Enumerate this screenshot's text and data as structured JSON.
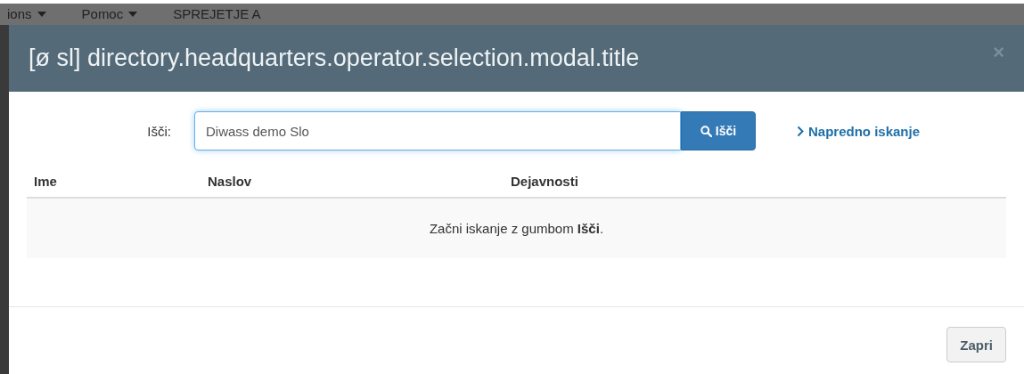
{
  "background_nav": {
    "items": [
      {
        "label": "ions",
        "caret": true
      },
      {
        "label": "Pomoc",
        "caret": true
      },
      {
        "label": "SPREJETJE A",
        "caret": false
      }
    ]
  },
  "modal": {
    "title": "[ø sl] directory.headquarters.operator.selection.modal.title",
    "close_symbol": "×",
    "search": {
      "label": "Išči:",
      "value": "Diwass demo Slo",
      "button": "Išči",
      "advanced_link": "Napredno iskanje"
    },
    "table": {
      "columns": [
        "Ime",
        "Naslov",
        "Dejavnosti"
      ],
      "empty_message": "Začni iskanje z gumbom **Išči**."
    },
    "footer": {
      "buttons": [
        "Zapri"
      ]
    }
  }
}
